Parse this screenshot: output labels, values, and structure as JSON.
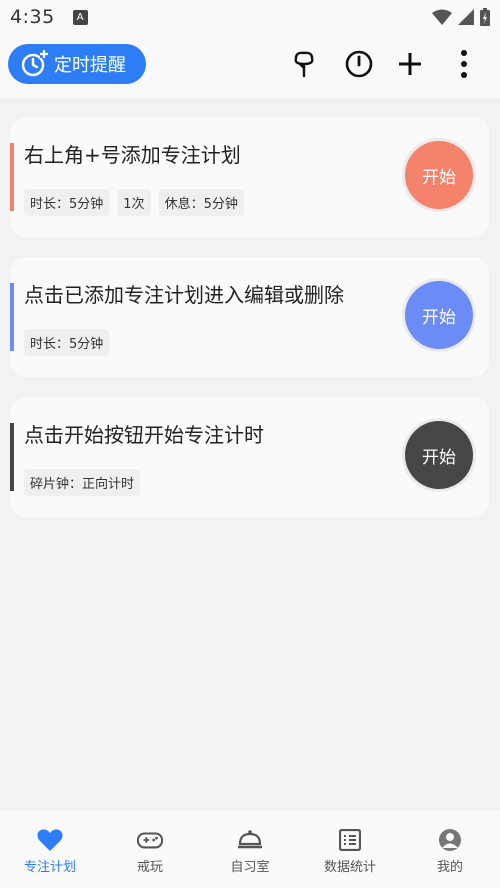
{
  "status_bar": {
    "time": "4:35",
    "notification_icon": "a-icon"
  },
  "header": {
    "reminder_label": "定时提醒",
    "icons": [
      "tree-icon",
      "timer-icon",
      "add-icon",
      "more-icon"
    ]
  },
  "plans": [
    {
      "title": "右上角+号添加专注计划",
      "tags": [
        "时长：5分钟",
        "1次",
        "休息：5分钟"
      ],
      "start_label": "开始",
      "color": "#f5826a",
      "bar_color": "#f5826a"
    },
    {
      "title": "点击已添加专注计划进入编辑或删除",
      "tags": [
        "时长：5分钟"
      ],
      "start_label": "开始",
      "color": "#6b8bf7",
      "bar_color": "#6b8bf7"
    },
    {
      "title": "点击开始按钮开始专注计时",
      "tags": [
        "碎片钟：正向计时"
      ],
      "start_label": "开始",
      "color": "#464646",
      "bar_color": "#464646"
    }
  ],
  "nav": {
    "items": [
      {
        "label": "专注计划",
        "icon": "heart-icon",
        "active": true
      },
      {
        "label": "戒玩",
        "icon": "gamepad-icon",
        "active": false
      },
      {
        "label": "自习室",
        "icon": "bell-icon",
        "active": false
      },
      {
        "label": "数据统计",
        "icon": "list-icon",
        "active": false
      },
      {
        "label": "我的",
        "icon": "person-icon",
        "active": false
      }
    ]
  },
  "colors": {
    "accent": "#2d7df6",
    "inactive": "#555555"
  }
}
